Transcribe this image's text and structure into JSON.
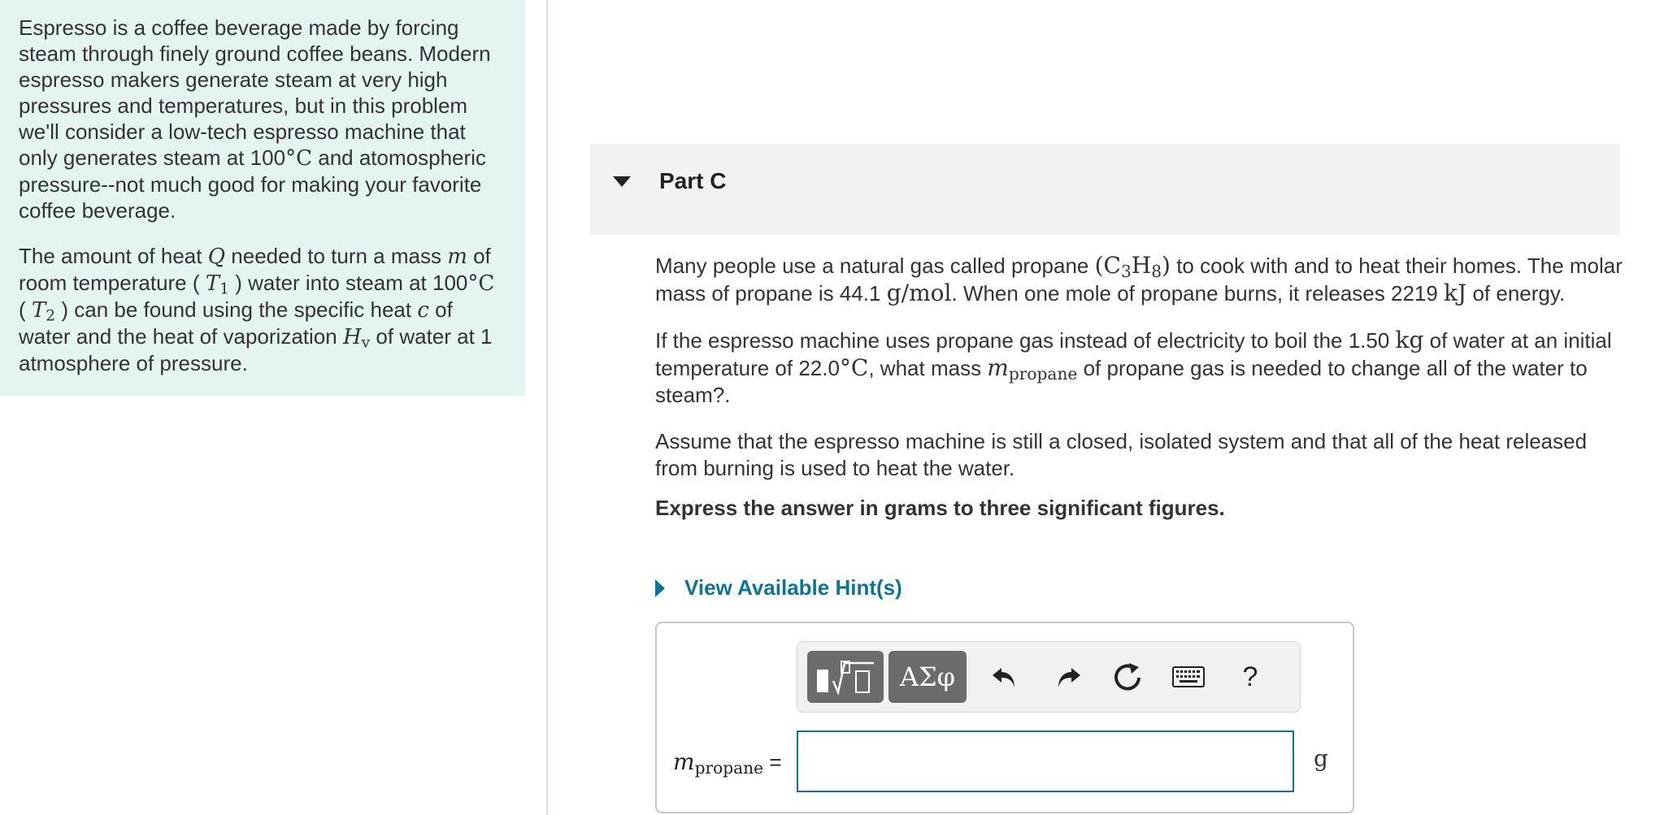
{
  "intro": {
    "p1": {
      "a": "Espresso is a coffee beverage made by forcing steam through finely ground coffee beans. Modern espresso makers generate steam at very high pressures and temperatures, but in this problem we'll consider a low-tech espresso machine that only generates steam at 100",
      "unit": "°C",
      "b": " and atomospheric pressure--not much good for making your favorite coffee beverage."
    },
    "p2": {
      "t1": "The amount of heat ",
      "Q": "Q",
      "t2": " needed to turn a mass ",
      "m": "m",
      "t3": " of room temperature ( ",
      "T1_base": "T",
      "T1_sub": "1",
      "t4": " ) water into steam at 100",
      "unit": "°C",
      "t5": " ( ",
      "T2_base": "T",
      "T2_sub": "2",
      "t6": " ) can be found using the specific heat ",
      "c": "c",
      "t7": " of water and the heat of vaporization ",
      "Hv_base": "H",
      "Hv_sub": "v",
      "t8": " of water at 1 atmosphere of pressure."
    }
  },
  "part": {
    "title": "Part C"
  },
  "problem": {
    "p1": {
      "t1": "Many people use a natural gas called propane ",
      "formula_open": "(C",
      "c_sub": "3",
      "h": "H",
      "h_sub": "8",
      "formula_close": ")",
      "t2": " to cook with and to heat their homes. The molar mass of propane is 44.1 ",
      "unit1": "g/mol",
      "t3": ". When one mole of propane burns, it releases 2219 ",
      "unit2": "kJ",
      "t4": " of energy."
    },
    "p2": {
      "t1": "If the espresso machine uses propane gas instead of electricity to boil the 1.50 ",
      "unit1": "kg",
      "t2": " of water at an initial temperature of 22.0",
      "unit2": "°C",
      "t3": ", what mass ",
      "m": "m",
      "m_sub": "propane",
      "t4": " of propane gas is needed to change all of the water to steam?."
    },
    "p3": "Assume that the espresso machine is still a closed, isolated system and that all of the heat released from burning is used to heat the water.",
    "instruction": "Express the answer in grams to three significant figures."
  },
  "hint": {
    "label": "View Available Hint(s)"
  },
  "toolbar": {
    "greek_label": "ΑΣφ",
    "help_label": "?",
    "icons": [
      "templates-icon",
      "greek-symbols-icon",
      "undo-icon",
      "redo-icon",
      "reset-icon",
      "keyboard-icon",
      "help-icon"
    ]
  },
  "answer": {
    "label_var": "m",
    "label_sub": "propane",
    "equals": "=",
    "value": "",
    "unit": "g"
  },
  "colors": {
    "panel_bg": "#e3f4f3",
    "link": "#0b7599",
    "input_border": "#0b7599",
    "toolbar_button": "#6b6b6b",
    "header_bg": "#f2f2f2"
  }
}
